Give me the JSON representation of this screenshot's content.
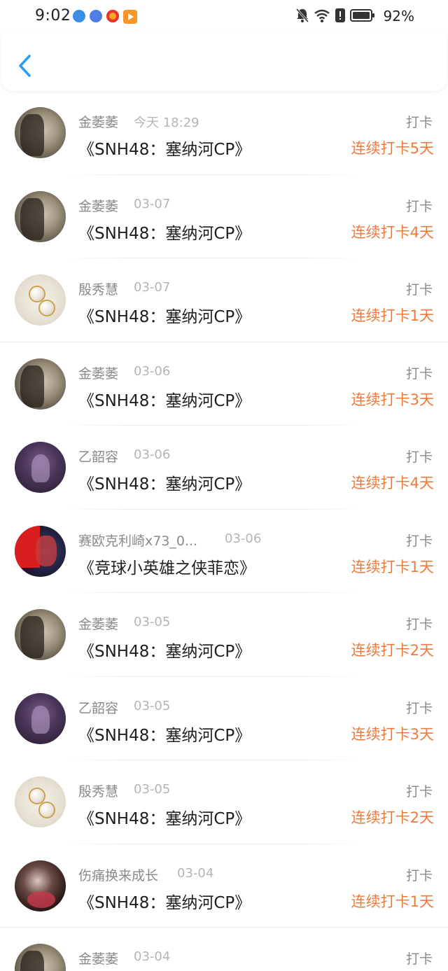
{
  "status_bar": {
    "time": "9:02",
    "battery": "92%",
    "app_icons": [
      "telegram-icon",
      "music-icon",
      "weibo-icon",
      "video-icon"
    ],
    "system_icons": [
      "mute-icon",
      "wifi-icon",
      "alert-icon",
      "battery-icon"
    ]
  },
  "header": {
    "back_icon": "chevron-left-icon"
  },
  "colors": {
    "accent": "#2a9df4",
    "streak": "#f07a3c",
    "muted": "#8a8a8a"
  },
  "entries": [
    {
      "name": "金萎萎",
      "date": "今天 18:29",
      "title": "《SNH48：塞纳河CP》",
      "checkin": "打卡",
      "streak": "连续打卡5天",
      "avatar": "av-girl"
    },
    {
      "name": "金萎萎",
      "date": "03-07",
      "title": "《SNH48：塞纳河CP》",
      "checkin": "打卡",
      "streak": "连续打卡4天",
      "avatar": "av-girl"
    },
    {
      "name": "殷秀慧",
      "date": "03-07",
      "title": "《SNH48：塞纳河CP》",
      "checkin": "打卡",
      "streak": "连续打卡1天",
      "avatar": "av-pearl"
    },
    {
      "name": "金萎萎",
      "date": "03-06",
      "title": "《SNH48：塞纳河CP》",
      "checkin": "打卡",
      "streak": "连续打卡3天",
      "avatar": "av-girl"
    },
    {
      "name": "乙韶容",
      "date": "03-06",
      "title": "《SNH48：塞纳河CP》",
      "checkin": "打卡",
      "streak": "连续打卡4天",
      "avatar": "av-anime"
    },
    {
      "name": "赛欧克利崎x73_0...",
      "date": "03-06",
      "title": "《竞球小英雄之侠菲恋》",
      "checkin": "打卡",
      "streak": "连续打卡1天",
      "avatar": "av-flag"
    },
    {
      "name": "金萎萎",
      "date": "03-05",
      "title": "《SNH48：塞纳河CP》",
      "checkin": "打卡",
      "streak": "连续打卡2天",
      "avatar": "av-girl"
    },
    {
      "name": "乙韶容",
      "date": "03-05",
      "title": "《SNH48：塞纳河CP》",
      "checkin": "打卡",
      "streak": "连续打卡3天",
      "avatar": "av-anime"
    },
    {
      "name": "殷秀慧",
      "date": "03-05",
      "title": "《SNH48：塞纳河CP》",
      "checkin": "打卡",
      "streak": "连续打卡2天",
      "avatar": "av-pearl"
    },
    {
      "name": "伤痛换来成长",
      "date": "03-04",
      "title": "《SNH48：塞纳河CP》",
      "checkin": "打卡",
      "streak": "连续打卡1天",
      "avatar": "av-dark"
    },
    {
      "name": "金萎萎",
      "date": "03-04",
      "title": "",
      "checkin": "打卡",
      "streak": "",
      "avatar": "av-girl"
    }
  ]
}
